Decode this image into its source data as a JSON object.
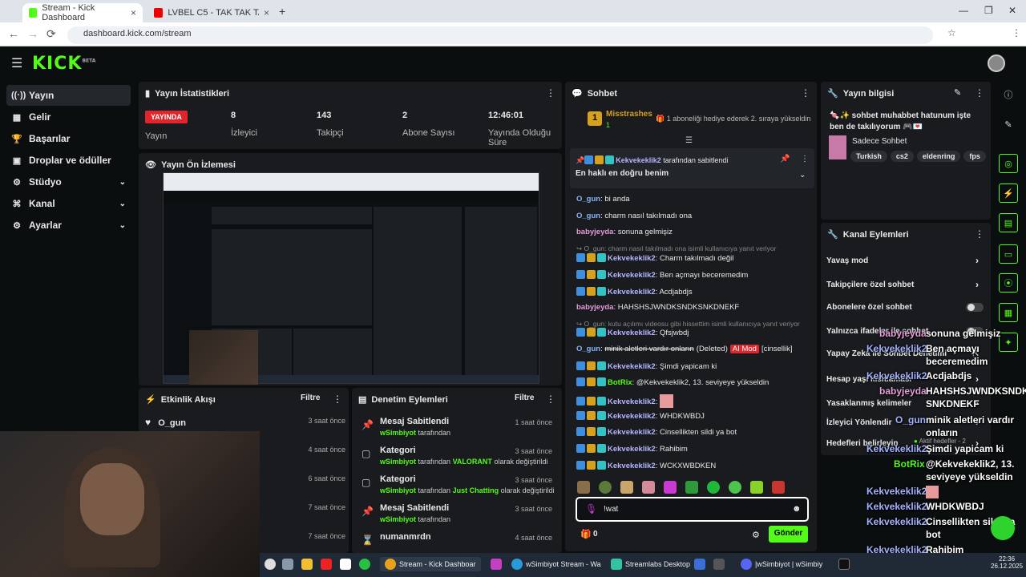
{
  "browser": {
    "tabs": [
      {
        "title": "Stream - Kick Dashboard"
      },
      {
        "title": "LVBEL C5 - TAK TAK TAK (1960'"
      }
    ],
    "url": "dashboard.kick.com/stream"
  },
  "header": {
    "logo": "KICK",
    "logo_sup": "BETA"
  },
  "sidebar": {
    "items": [
      {
        "label": "Yayın",
        "icon": "broadcast-icon",
        "active": true
      },
      {
        "label": "Gelir",
        "icon": "money-icon"
      },
      {
        "label": "Başarılar",
        "icon": "trophy-icon"
      },
      {
        "label": "Droplar ve ödüller",
        "icon": "gift-icon"
      },
      {
        "label": "Stüdyo",
        "icon": "studio-icon",
        "expandable": true
      },
      {
        "label": "Kanal",
        "icon": "channel-icon",
        "expandable": true
      },
      {
        "label": "Ayarlar",
        "icon": "gear-icon",
        "expandable": true
      }
    ]
  },
  "stats": {
    "title": "Yayın İstatistikleri",
    "live_badge": "YAYINDA",
    "items": [
      {
        "label": "Yayın"
      },
      {
        "value": "8",
        "label": "İzleyici"
      },
      {
        "value": "143",
        "label": "Takipçi"
      },
      {
        "value": "2",
        "label": "Abone Sayısı"
      },
      {
        "value": "12:46:01",
        "label": "Yayında Olduğu Süre"
      }
    ]
  },
  "preview": {
    "title": "Yayın Ön İzlemesi"
  },
  "events": {
    "title": "Etkinlik Akışı",
    "filter": "Filtre",
    "rows": [
      {
        "user": "O_gun",
        "time": "3 saat önce"
      },
      {
        "time": "4 saat önce"
      },
      {
        "time": "6 saat önce"
      },
      {
        "time": "7 saat önce"
      },
      {
        "time": "7 saat önce"
      }
    ]
  },
  "moderation": {
    "title": "Denetim Eylemleri",
    "filter": "Filtre",
    "rows": [
      {
        "title": "Mesaj Sabitlendi",
        "user": "wSimbiyot",
        "sub": "tarafından",
        "time": "1 saat önce",
        "icon": "pin-icon"
      },
      {
        "title": "Kategori",
        "user": "wSimbiyot",
        "sub": "tarafından",
        "cat": "VALORANT",
        "sub2": "olarak değiştirildi",
        "time": "3 saat önce",
        "icon": "category-icon"
      },
      {
        "title": "Kategori",
        "user": "wSimbiyot",
        "sub": "tarafından",
        "cat": "Just Chatting",
        "sub2": "olarak değiştirildi",
        "time": "3 saat önce",
        "icon": "category-icon"
      },
      {
        "title": "Mesaj Sabitlendi",
        "user": "wSimbiyot",
        "sub": "tarafından",
        "time": "3 saat önce",
        "icon": "pin-icon"
      },
      {
        "title": "numanmrdn",
        "time": "4 saat önce",
        "icon": "hourglass-icon"
      }
    ]
  },
  "chat": {
    "title": "Sohbet",
    "top_gifter": {
      "rank": "1",
      "name": "Misstrashes",
      "count": "1",
      "note": "1 aboneliği hediye ederek 2. sıraya yükseldin"
    },
    "pinned": {
      "by_user": "Kekvekeklik2",
      "by_text": "tarafından sabitlendi",
      "text": "En haklı en doğru benim"
    },
    "messages": [
      {
        "user": "O_gun",
        "text": "bi anda",
        "color": "ublue"
      },
      {
        "user": "O_gun",
        "text": "charm nasıl takılmadı ona",
        "color": "ublue"
      },
      {
        "user": "babyjeyda",
        "text": "sonuna gelmişiz",
        "color": "upink"
      },
      {
        "reply": "↪ O_gun: charm nasıl takılmadı ona isimli kullanıcıya yanıt veriyor"
      },
      {
        "user": "Kekvekeklik2",
        "text": "Charm takılmadı değil",
        "color": "ulav",
        "badges": true
      },
      {
        "user": "Kekvekeklik2",
        "text": "Ben açmayı beceremedim",
        "color": "ulav",
        "badges": true
      },
      {
        "user": "Kekvekeklik2",
        "text": "Acdjabdjs",
        "color": "ulav",
        "badges": true
      },
      {
        "user": "babyjeyda",
        "text": "HAHSHSJWNDKSNDKSNKDNEKF",
        "color": "upink"
      },
      {
        "reply": "↪ O_gun: kutu açılımı videosu gibi hissettim isimli kullanıcıya yanıt veriyor"
      },
      {
        "user": "Kekvekeklik2",
        "text": "Qfsjwbdj",
        "color": "ulav",
        "badges": true
      },
      {
        "user": "O_gun",
        "text": "minik aletleri vardır onların",
        "deleted": "(Deleted)",
        "mod": "AI Mod",
        "flag": "[cinsellik]",
        "color": "ublue"
      },
      {
        "user": "Kekvekeklik2",
        "text": "Şimdi yapicam ki",
        "color": "ulav",
        "badges": true
      },
      {
        "user": "BotRix",
        "text": "@Kekvekeklik2, 13. seviyeye yükseldin",
        "color": "ugreen",
        "badges": true
      },
      {
        "user": "Kekvekeklik2",
        "text": "",
        "emote": true,
        "color": "ulav",
        "badges": true
      },
      {
        "user": "Kekvekeklik2",
        "text": "WHDKWBDJ",
        "color": "ulav",
        "badges": true
      },
      {
        "user": "Kekvekeklik2",
        "text": "Cinsellikten sildi ya bot",
        "color": "ulav",
        "badges": true
      },
      {
        "user": "Kekvekeklik2",
        "text": "Rahibim",
        "color": "ulav",
        "badges": true
      },
      {
        "user": "Kekvekeklik2",
        "text": "WCKXWBDKEN",
        "color": "ulav",
        "badges": true
      }
    ],
    "input_value": "!wat",
    "points": "0",
    "send_label": "Gönder"
  },
  "stream_info": {
    "title": "Yayın bilgisi",
    "text": "🍬✨ sohbet muhabbet hatunum işte ben de takılıyorum 🎮💌",
    "category": "Sadece Sohbet",
    "tags": [
      "Turkish",
      "cs2",
      "eldenring",
      "fps"
    ]
  },
  "channel_actions": {
    "title": "Kanal Eylemleri",
    "items": [
      {
        "label": "Yavaş mod",
        "type": "arrow"
      },
      {
        "label": "Takipçilere özel sohbet",
        "type": "arrow"
      },
      {
        "label": "Abonelere özel sohbet",
        "type": "toggle"
      },
      {
        "label": "Yalnızca ifadeler ile sohbet",
        "type": "toggle"
      },
      {
        "label": "Yapay Zeka ile Sohbet Denetimi",
        "type": "link"
      },
      {
        "label": "Hesap yaşı kısıtlaması",
        "type": "arrow"
      },
      {
        "label": "Yasaklanmış kelimeler",
        "type": "arrow"
      },
      {
        "label": "İzleyici Yönlendir",
        "type": "arrow"
      },
      {
        "label": "Hedefleri belirleyin",
        "sub": "Aktif hedefler - 2",
        "type": "arrow"
      }
    ]
  },
  "overlay_chat": [
    {
      "user": "babyjeyda",
      "text": "sonuna gelmişiz",
      "c": "u2"
    },
    {
      "user": "Kekvekeklik2",
      "text": "Ben açmayı",
      "c": "u1"
    },
    {
      "user": "",
      "text": "beceremedim",
      "c": "u1"
    },
    {
      "user": "Kekvekeklik2",
      "text": "Acdjabdjs",
      "c": "u1"
    },
    {
      "user": "babyjeyda",
      "text": "HAHSHSJWNDKSNDK",
      "c": "u2"
    },
    {
      "user": "",
      "text": "SNKDNEKF",
      "c": "u2"
    },
    {
      "user": "O_gun",
      "text": "minik aletleri vardır",
      "c": "u1"
    },
    {
      "user": "",
      "text": "onların",
      "c": "u1"
    },
    {
      "user": "Kekvekeklik2",
      "text": "Şimdi yapicam ki",
      "c": "u1"
    },
    {
      "user": "BotRix",
      "text": "@Kekvekeklik2, 13.",
      "c": "u3"
    },
    {
      "user": "",
      "text": "seviyeye yükseldin",
      "c": "u3"
    },
    {
      "user": "Kekvekeklik2",
      "text": "",
      "c": "u1"
    },
    {
      "user": "Kekvekeklik2",
      "text": "WHDKWBDJ",
      "c": "u1"
    },
    {
      "user": "Kekvekeklik2",
      "text": "Cinsellikten sildi ya",
      "c": "u1"
    },
    {
      "user": "",
      "text": "bot",
      "c": "u1"
    },
    {
      "user": "Kekvekeklik2",
      "text": "Rahibim",
      "c": "u1"
    },
    {
      "user": "Kekvekeklik2",
      "text": "WCKXWBDKEN",
      "c": "u1"
    }
  ],
  "taskbar": {
    "items": [
      "Stream - Kick Dashboar",
      "wSimbiyot Stream - Wa",
      "Streamlabs Desktop",
      "|wSimbiyot | wSimbiy"
    ],
    "time": "22:36",
    "date": "26.12.2025"
  },
  "colors": {
    "accent": "#53fc18",
    "live": "#e0252c",
    "panel": "#191b1f",
    "bg": "#0b0e0f"
  }
}
